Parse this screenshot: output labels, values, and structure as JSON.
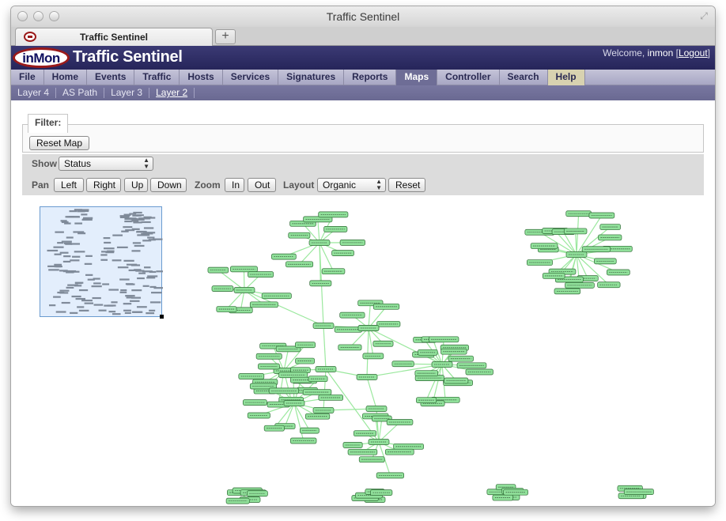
{
  "window": {
    "title": "Traffic Sentinel"
  },
  "browser": {
    "tab_title": "Traffic Sentinel",
    "new_tab_label": "+"
  },
  "header": {
    "logo_text": "inMon",
    "app_title": "Traffic Sentinel",
    "welcome_prefix": "Welcome,",
    "username": "inmon",
    "logout_label": "Logout"
  },
  "nav": {
    "items": [
      "File",
      "Home",
      "Events",
      "Traffic",
      "Hosts",
      "Services",
      "Signatures",
      "Reports",
      "Maps",
      "Controller",
      "Search",
      "Help"
    ],
    "active": "Maps"
  },
  "subnav": {
    "items": [
      "Layer 4",
      "AS Path",
      "Layer 3",
      "Layer 2"
    ],
    "active": "Layer 2"
  },
  "filter": {
    "legend": "Filter:",
    "reset_map_label": "Reset Map"
  },
  "controls": {
    "show_label": "Show",
    "show_value": "Status",
    "pan_label": "Pan",
    "pan_buttons": [
      "Left",
      "Right",
      "Up",
      "Down"
    ],
    "zoom_label": "Zoom",
    "zoom_buttons": [
      "In",
      "Out"
    ],
    "layout_label": "Layout",
    "layout_value": "Organic",
    "layout_reset_label": "Reset"
  },
  "map": {
    "node_fill": "#90e09a",
    "node_stroke": "#2f6a35",
    "edge_color": "#9be89e"
  }
}
